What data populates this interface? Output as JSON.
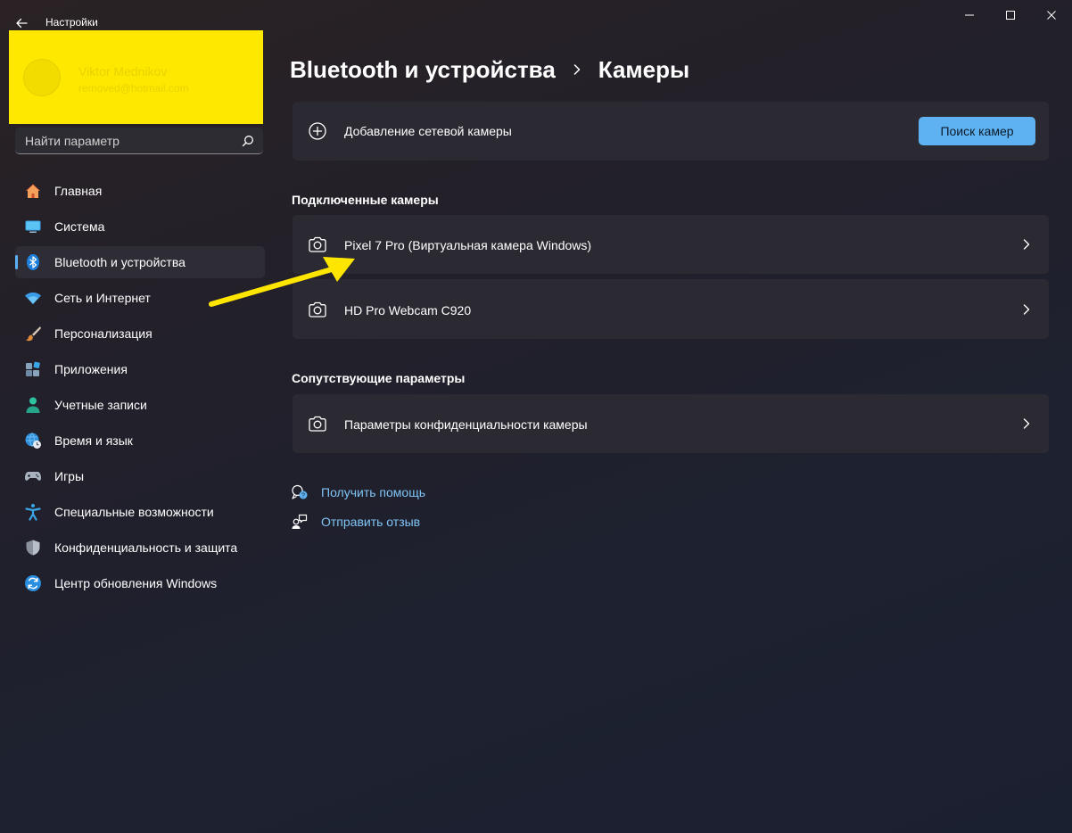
{
  "window": {
    "app_title": "Настройки",
    "icons": {
      "back": "back-arrow-icon",
      "minimize": "minimize-icon",
      "maximize": "maximize-icon",
      "close": "close-icon"
    }
  },
  "profile": {
    "name": "Viktor Mednikov",
    "email": "removed@hotmail.com",
    "redaction_color": "#ffe800"
  },
  "search": {
    "placeholder": "Найти параметр",
    "value": ""
  },
  "sidebar": {
    "items": [
      {
        "label": "Главная",
        "icon": "home-icon"
      },
      {
        "label": "Система",
        "icon": "monitor-icon"
      },
      {
        "label": "Bluetooth и устройства",
        "icon": "bluetooth-icon",
        "active": true
      },
      {
        "label": "Сеть и Интернет",
        "icon": "wifi-icon"
      },
      {
        "label": "Персонализация",
        "icon": "brush-icon"
      },
      {
        "label": "Приложения",
        "icon": "apps-icon"
      },
      {
        "label": "Учетные записи",
        "icon": "accounts-icon"
      },
      {
        "label": "Время и язык",
        "icon": "globe-clock-icon"
      },
      {
        "label": "Игры",
        "icon": "gamepad-icon"
      },
      {
        "label": "Специальные возможности",
        "icon": "accessibility-icon"
      },
      {
        "label": "Конфиденциальность и защита",
        "icon": "shield-icon"
      },
      {
        "label": "Центр обновления Windows",
        "icon": "update-icon"
      }
    ]
  },
  "breadcrumb": {
    "parent": "Bluetooth и устройства",
    "current": "Камеры"
  },
  "add_camera": {
    "label": "Добавление сетевой камеры",
    "button": "Поиск камер",
    "icon": "plus-circle-icon"
  },
  "connected": {
    "title": "Подключенные камеры",
    "items": [
      {
        "label": "Pixel 7 Pro (Виртуальная камера Windows)",
        "icon": "camera-icon"
      },
      {
        "label": "HD Pro Webcam C920",
        "icon": "camera-icon"
      }
    ]
  },
  "related": {
    "title": "Сопутствующие параметры",
    "items": [
      {
        "label": "Параметры конфиденциальности камеры",
        "icon": "camera-icon"
      }
    ]
  },
  "help": {
    "get_help": "Получить помощь",
    "feedback": "Отправить отзыв"
  },
  "colors": {
    "accent": "#5fb2f2",
    "link": "#7fc4f5",
    "card": "#2b2a32",
    "annotation_arrow": "#ffe600"
  }
}
